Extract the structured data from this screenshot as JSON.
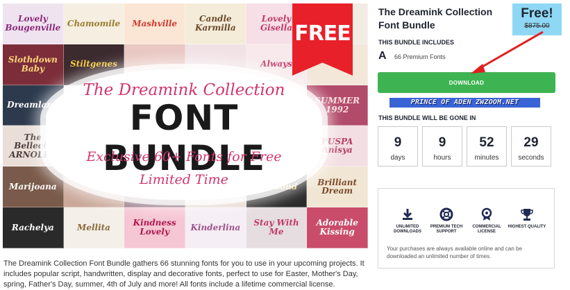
{
  "hero": {
    "banner_title": "The Dreamink Collection",
    "banner_main": "FONT BUNDLE",
    "banner_sub": "Exclusive 60+ Fonts for Free",
    "banner_sub2": "Limited Time",
    "free_ribbon": "FREE",
    "tiles": [
      {
        "text": "Lovely Bougenville",
        "bg": "#efe3f0",
        "fg": "#8a2a78"
      },
      {
        "text": "Chamomile",
        "bg": "#f6efe1",
        "fg": "#9b7a2d"
      },
      {
        "text": "Mashville",
        "bg": "#fbe6d6",
        "fg": "#d13c2b"
      },
      {
        "text": "Candle Karmilla",
        "bg": "#f4ecd9",
        "fg": "#6d4a2a"
      },
      {
        "text": "Lovely Gisella",
        "bg": "#f6dfe6",
        "fg": "#c23a6b"
      },
      {
        "text": "",
        "bg": "#f2ece4",
        "fg": "#444"
      },
      {
        "text": "Slothdown Baby",
        "bg": "#7b2e3a",
        "fg": "#ffd37a"
      },
      {
        "text": "Stiltgenes",
        "bg": "#3b2a2e",
        "fg": "#f5c842"
      },
      {
        "text": "",
        "bg": "#e9c7c2",
        "fg": "#333"
      },
      {
        "text": "",
        "bg": "#f1e2e6",
        "fg": "#333"
      },
      {
        "text": "Always",
        "bg": "#f7e9ec",
        "fg": "#c23a6b"
      },
      {
        "text": "",
        "bg": "#f3e7da",
        "fg": "#333"
      },
      {
        "text": "Dreamland",
        "bg": "#2d3a4d",
        "fg": "#ffffff"
      },
      {
        "text": "",
        "bg": "#f6f0ef",
        "fg": "#333"
      },
      {
        "text": "",
        "bg": "#f6f0ef",
        "fg": "#333"
      },
      {
        "text": "",
        "bg": "#f6f0ef",
        "fg": "#333"
      },
      {
        "text": "",
        "bg": "#f6f0ef",
        "fg": "#333"
      },
      {
        "text": "SUMMER 1992",
        "bg": "#b24a6a",
        "fg": "#ffe0e0"
      },
      {
        "text": "The Bellecia ARNOLDY",
        "bg": "#eadfd8",
        "fg": "#4a3a3a"
      },
      {
        "text": "",
        "bg": "#f6f0ef",
        "fg": "#333"
      },
      {
        "text": "",
        "bg": "#f6f0ef",
        "fg": "#333"
      },
      {
        "text": "",
        "bg": "#f6f0ef",
        "fg": "#333"
      },
      {
        "text": "",
        "bg": "#f6f0ef",
        "fg": "#333"
      },
      {
        "text": "PUSPA Anisya",
        "bg": "#f3dfe3",
        "fg": "#b23a62"
      },
      {
        "text": "Marijoana",
        "bg": "#7a5a4a",
        "fg": "#ffffff"
      },
      {
        "text": "",
        "bg": "#caa89a",
        "fg": "#333"
      },
      {
        "text": "",
        "bg": "#8a6a7a",
        "fg": "#fff"
      },
      {
        "text": "",
        "bg": "#e6d6cc",
        "fg": "#333"
      },
      {
        "text": "Diamond",
        "bg": "#2b2b2b",
        "fg": "#f5d36a"
      },
      {
        "text": "Brilliant Dream",
        "bg": "#f1e6d3",
        "fg": "#7a4a2a"
      },
      {
        "text": "Rachelya",
        "bg": "#2a2a2a",
        "fg": "#ffffff"
      },
      {
        "text": "Mellita",
        "bg": "#f4efe8",
        "fg": "#8a6a3a"
      },
      {
        "text": "Kindness Lovely",
        "bg": "#f5c6d4",
        "fg": "#b1164f"
      },
      {
        "text": "Kinderlina",
        "bg": "#f5eef4",
        "fg": "#a0528c"
      },
      {
        "text": "Stay With Me",
        "bg": "#e6dde0",
        "fg": "#c23a6b"
      },
      {
        "text": "Adorable Kissing",
        "bg": "#c94d6a",
        "fg": "#ffffff"
      }
    ]
  },
  "description": "The Dreamink Collection Font Bundle gathers 66 stunning fonts for you to use in your upcoming projects. It includes popular script, handwritten, display and decorative fonts, perfect to use for Easter, Mother's Day, spring, Father's Day, summer, 4th of July and more! All fonts include a lifetime commercial license.",
  "panel": {
    "title": "The Dreamink Collection Font Bundle",
    "price_now": "Free!",
    "price_was": "$875.00",
    "includes_label": "THIS BUNDLE INCLUDES",
    "fonts_icon_glyph": "A",
    "fonts_count": "66 Premium Fonts",
    "download_label": "DOWNLOAD",
    "watermark": "PRINCE OF ADEN ZWZOOM.NET",
    "gone_label": "THIS BUNDLE WILL BE GONE IN",
    "countdown": [
      {
        "value": "9",
        "unit": "days"
      },
      {
        "value": "9",
        "unit": "hours"
      },
      {
        "value": "52",
        "unit": "minutes"
      },
      {
        "value": "29",
        "unit": "seconds"
      }
    ],
    "features": [
      {
        "label": "UNLIMITED DOWNLOADS",
        "icon": "download-icon"
      },
      {
        "label": "PREMIUM TECH SUPPORT",
        "icon": "lifebuoy-icon"
      },
      {
        "label": "COMMERCIAL LICENSE",
        "icon": "ribbon-badge-icon"
      },
      {
        "label": "HIGHEST QUALITY",
        "icon": "trophy-icon"
      }
    ],
    "features_note": "Your purchases are always available online and can be downloaded an unlimited number of times.",
    "colors": {
      "download_green": "#3eb352",
      "price_bg": "#8fd8f5",
      "arrow_red": "#e02020",
      "ribbon_red": "#e8202a",
      "accent_pink": "#d1356d"
    }
  }
}
